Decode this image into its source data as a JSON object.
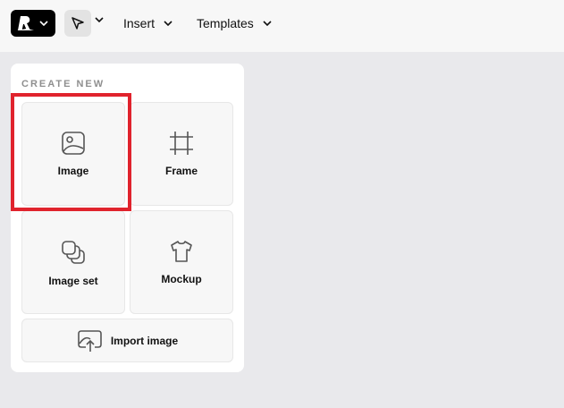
{
  "toolbar": {
    "logo_icon": "brand-logo-icon",
    "select_tool_icon": "cursor-arrow-icon",
    "menus": [
      {
        "label": "Insert"
      },
      {
        "label": "Templates"
      }
    ]
  },
  "panel": {
    "section_title": "CREATE NEW",
    "tiles": [
      {
        "label": "Image",
        "icon": "image-icon"
      },
      {
        "label": "Frame",
        "icon": "frame-crop-icon"
      },
      {
        "label": "Image set",
        "icon": "image-set-icon"
      },
      {
        "label": "Mockup",
        "icon": "tshirt-icon"
      }
    ],
    "import": {
      "label": "Import image",
      "icon": "import-image-icon"
    }
  },
  "colors": {
    "highlight": "#e0232d",
    "topbar_bg": "#f7f7f7",
    "canvas_bg": "#e9e9ec"
  }
}
